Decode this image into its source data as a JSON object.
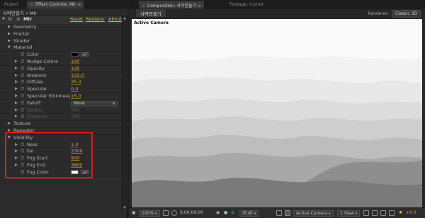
{
  "left_tabs": [
    "Project",
    "Effect Controls: Mir"
  ],
  "left_header": {
    "title": "사막만들기 • Mir"
  },
  "layer_row": {
    "fx": "fx",
    "name": "Mir",
    "reset": "Reset",
    "register": "Register",
    "about": "About..."
  },
  "rows": [
    {
      "label": "Geometry",
      "indent": 1,
      "triangle": "closed"
    },
    {
      "label": "Fractal",
      "indent": 1,
      "triangle": "closed"
    },
    {
      "label": "Shader",
      "indent": 1,
      "triangle": "closed"
    },
    {
      "label": "Material",
      "indent": 1,
      "triangle": "open"
    },
    {
      "label": "Color",
      "indent": 3,
      "kind": "color",
      "swatch": "#000000"
    },
    {
      "label": "Nudge Colors",
      "indent": 2,
      "value": "100"
    },
    {
      "label": "Opacity",
      "indent": 2,
      "value": "100"
    },
    {
      "label": "Ambient",
      "indent": 2,
      "value": "150.0"
    },
    {
      "label": "Diffuse",
      "indent": 2,
      "value": "35.0"
    },
    {
      "label": "Specular",
      "indent": 2,
      "value": "0.0"
    },
    {
      "label": "Specular Shininess",
      "indent": 2,
      "value": "15.0"
    },
    {
      "label": "Falloff",
      "indent": 2,
      "kind": "dropdown",
      "value": "None"
    },
    {
      "label": "Radius",
      "indent": 2,
      "value": "300",
      "dim": true
    },
    {
      "label": "Distance",
      "indent": 2,
      "value": "300",
      "dim": true
    },
    {
      "label": "Texture",
      "indent": 1,
      "triangle": "closed"
    },
    {
      "label": "Repeater",
      "indent": 1,
      "triangle": "closed"
    },
    {
      "label": "Visibility",
      "indent": 1,
      "triangle": "open"
    },
    {
      "label": "Near",
      "indent": 2,
      "value": "1.0"
    },
    {
      "label": "Far",
      "indent": 2,
      "value": "3300"
    },
    {
      "label": "Fog Start",
      "indent": 2,
      "value": "900"
    },
    {
      "label": "Fog End",
      "indent": 2,
      "value": "3800"
    },
    {
      "label": "Fog Color",
      "indent": 3,
      "kind": "color",
      "swatch": "#ffffff"
    }
  ],
  "right_tabs": [
    "Composition: 사막만들기",
    "Footage: (none)"
  ],
  "comp_tab": "사막만들기",
  "renderer": {
    "label": "Renderer:",
    "value": "Classic 3D"
  },
  "viewport": {
    "camera_label": "Active Camera"
  },
  "bottom_bar": {
    "zoom": "100%",
    "timecode": "0;00;00;00",
    "resolution": "(Full)",
    "camera": "Active Camera",
    "views": "1 View",
    "exposure": "+0.0"
  },
  "colors": {
    "link": "#d8a63b",
    "highlight": "#d81e1e",
    "panel": "#2b2b2b",
    "tab_close": "#c85a5a"
  }
}
